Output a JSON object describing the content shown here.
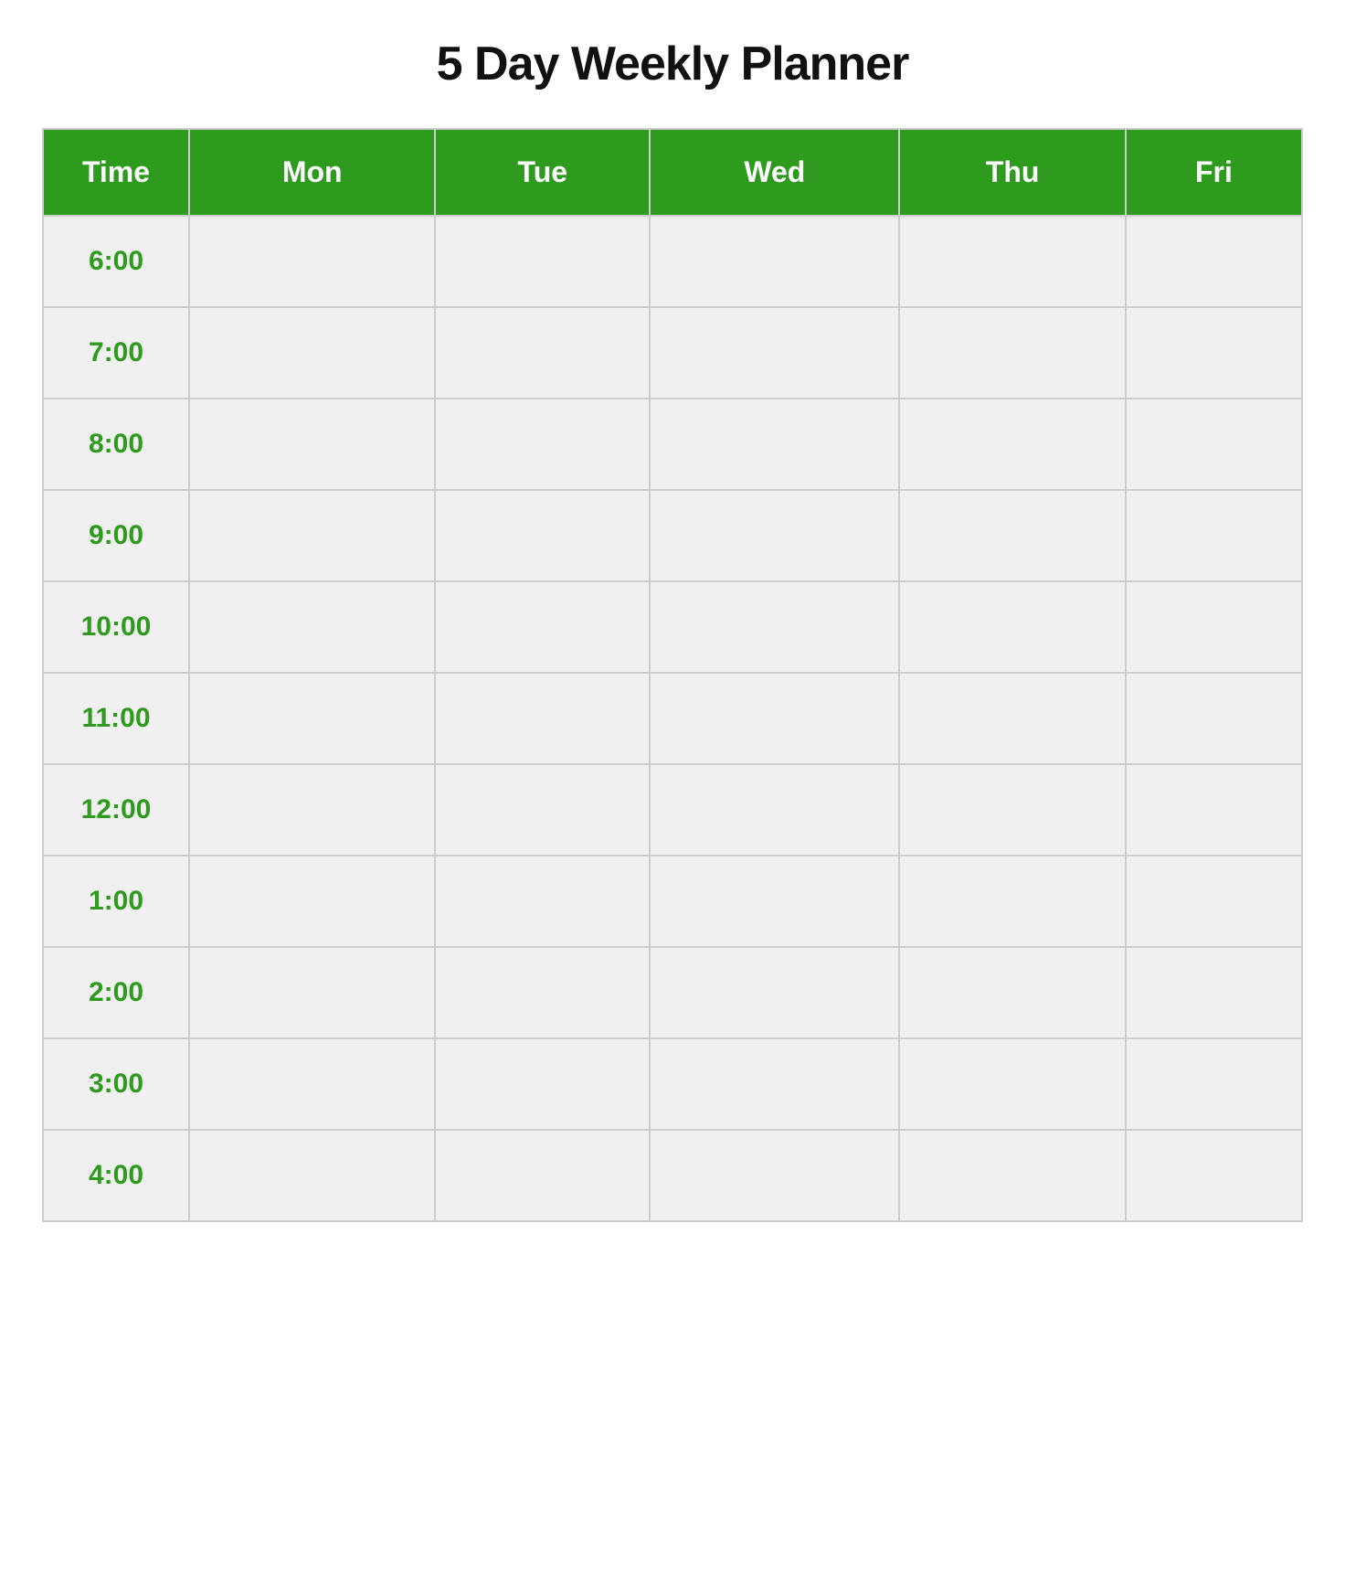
{
  "title": "5 Day Weekly Planner",
  "header": {
    "columns": [
      {
        "id": "time",
        "label": "Time"
      },
      {
        "id": "mon",
        "label": "Mon"
      },
      {
        "id": "tue",
        "label": "Tue"
      },
      {
        "id": "wed",
        "label": "Wed"
      },
      {
        "id": "thu",
        "label": "Thu"
      },
      {
        "id": "fri",
        "label": "Fri"
      }
    ]
  },
  "rows": [
    {
      "time": "6:00"
    },
    {
      "time": "7:00"
    },
    {
      "time": "8:00"
    },
    {
      "time": "9:00"
    },
    {
      "time": "10:00"
    },
    {
      "time": "11:00"
    },
    {
      "time": "12:00"
    },
    {
      "time": "1:00"
    },
    {
      "time": "2:00"
    },
    {
      "time": "3:00"
    },
    {
      "time": "4:00"
    }
  ]
}
